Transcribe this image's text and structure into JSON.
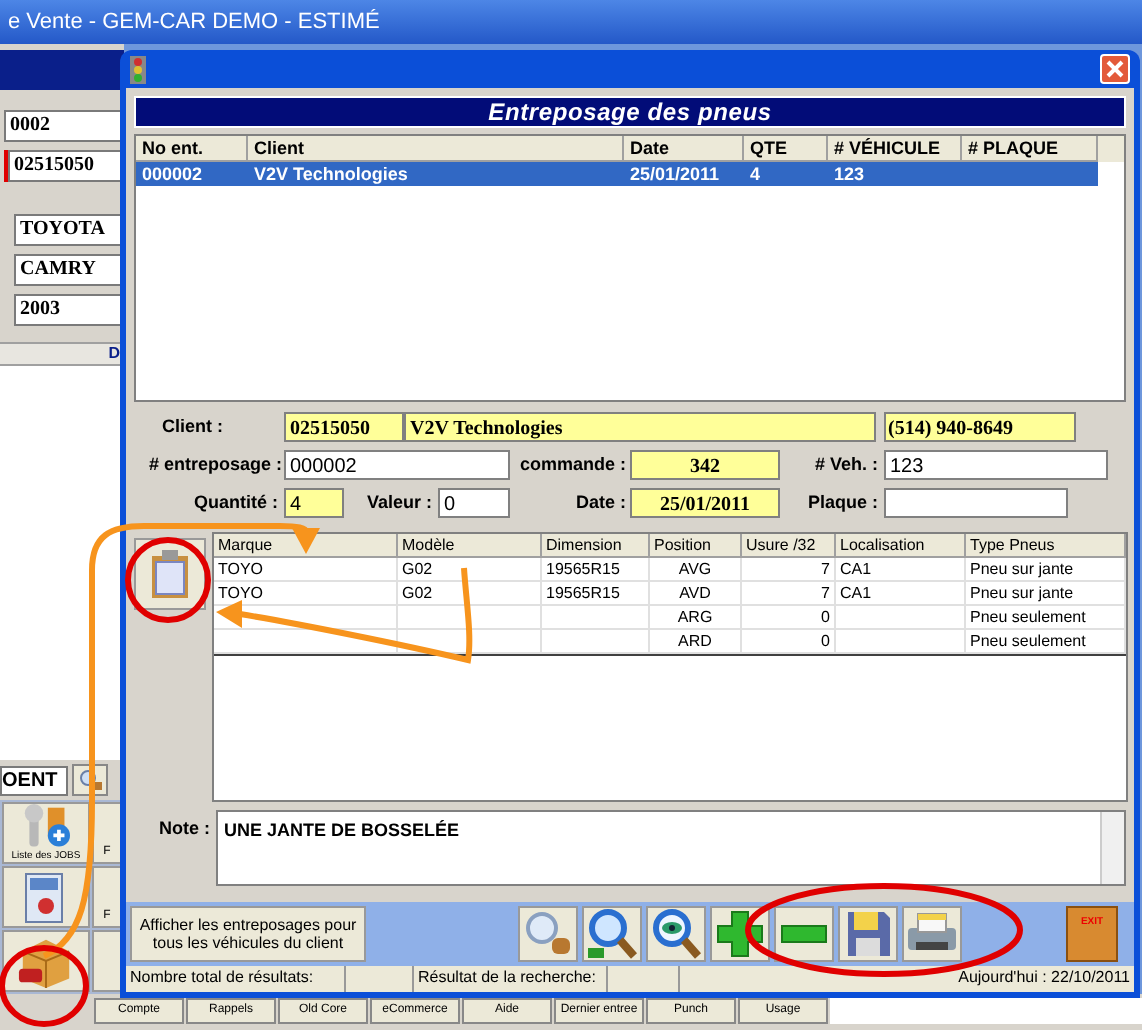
{
  "background_window": {
    "title": "e Vente - GEM-CAR DEMO - ESTIMÉ",
    "fields": [
      "0002",
      "02515050",
      "TOYOTA",
      "CAMRY",
      "2003"
    ],
    "section_letter": "D",
    "search_field": "OENT",
    "tiles": [
      {
        "kind": "wrench",
        "label": "Liste des JOBS",
        "side_label": "F"
      },
      {
        "kind": "papers",
        "side_label": "F"
      },
      {
        "kind": "box"
      }
    ],
    "taskbar": [
      "Compte",
      "Rappels",
      "Old Core",
      "eCommerce",
      "Aide",
      "Dernier entree",
      "Punch",
      "Usage"
    ]
  },
  "dialog": {
    "header": "Entreposage des pneus",
    "list": {
      "columns": [
        "No ent.",
        "Client",
        "Date",
        "QTE",
        "# VÉHICULE",
        "# PLAQUE"
      ],
      "rows": [
        {
          "cells": [
            "000002",
            "V2V Technologies",
            "25/01/2011",
            "4",
            "123",
            ""
          ],
          "selected": true
        }
      ]
    },
    "form": {
      "client_label": "Client :",
      "client_code": "02515050",
      "client_name": "V2V Technologies",
      "phone": "(514) 940-8649",
      "storage_label": "# entreposage :",
      "storage_no": "000002",
      "order_label": "commande :",
      "order_no": "342",
      "vehicle_label": "# Veh. :",
      "vehicle_no": "123",
      "quantity_label": "Quantité :",
      "quantity": "4",
      "value_label": "Valeur :",
      "value": "0",
      "date_label": "Date :",
      "date": "25/01/2011",
      "plate_label": "Plaque :"
    },
    "tires": {
      "columns": [
        "Marque",
        "Modèle",
        "Dimension",
        "Position",
        "Usure /32",
        "Localisation",
        "Type Pneus"
      ],
      "rows": [
        [
          "TOYO",
          "G02",
          "19565R15",
          "AVG",
          "7",
          "CA1",
          "Pneu sur jante"
        ],
        [
          "TOYO",
          "G02",
          "19565R15",
          "AVD",
          "7",
          "CA1",
          "Pneu sur jante"
        ],
        [
          "",
          "",
          "",
          "ARG",
          "0",
          "",
          "Pneu seulement"
        ],
        [
          "",
          "",
          "",
          "ARD",
          "0",
          "",
          "Pneu seulement"
        ]
      ]
    },
    "note_label": "Note :",
    "note": "UNE JANTE DE BOSSELÉE",
    "show_all_button": "Afficher les entreposages pour tous les véhicules du client",
    "toolbar": [
      {
        "kind": "person-search"
      },
      {
        "kind": "search"
      },
      {
        "kind": "eye-search"
      },
      {
        "kind": "add"
      },
      {
        "kind": "remove"
      },
      {
        "kind": "save"
      },
      {
        "kind": "print"
      }
    ],
    "exit_label": "EXIT",
    "status": {
      "total_label": "Nombre total de résultats:",
      "result_label": "Résultat de la recherche:",
      "today": "Aujourd'hui : 22/10/2011"
    }
  }
}
